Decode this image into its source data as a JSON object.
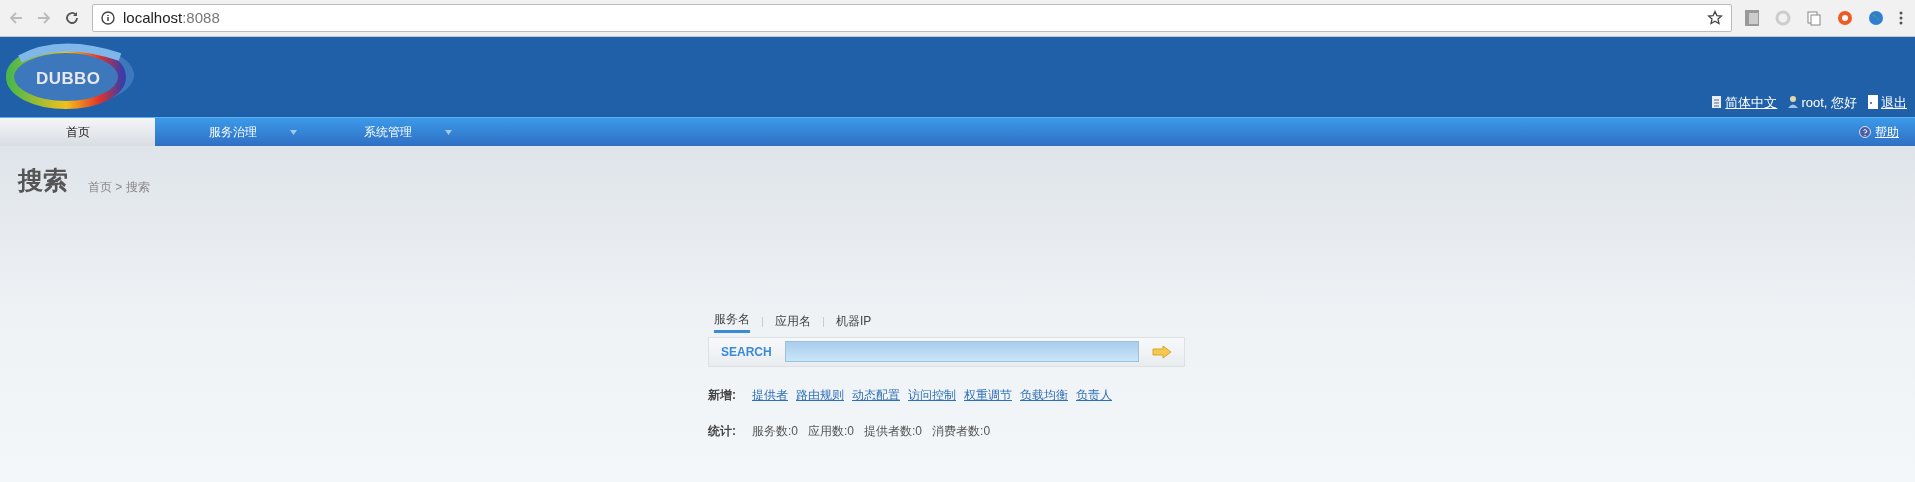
{
  "browser": {
    "url_host": "localhost",
    "url_port": ":8088"
  },
  "header": {
    "logo_text": "DUBBO",
    "links": [
      {
        "kind": "language",
        "label": "简体中文"
      },
      {
        "kind": "user",
        "label": "root, 您好"
      },
      {
        "kind": "logout",
        "label": "退出"
      }
    ]
  },
  "nav": {
    "items": [
      {
        "label": "首页",
        "selected": true,
        "dropdown": false
      },
      {
        "label": "服务治理",
        "selected": false,
        "dropdown": true
      },
      {
        "label": "系统管理",
        "selected": false,
        "dropdown": true
      }
    ],
    "help": "帮助"
  },
  "page": {
    "title": "搜索",
    "breadcrumb": "首页 > 搜索"
  },
  "search": {
    "tabs": [
      {
        "label": "服务名",
        "selected": true
      },
      {
        "label": "应用名",
        "selected": false
      },
      {
        "label": "机器IP",
        "selected": false
      }
    ],
    "label": "SEARCH"
  },
  "add": {
    "label": "新增:",
    "links": [
      "提供者",
      "路由规则",
      "动态配置",
      "访问控制",
      "权重调节",
      "负载均衡",
      "负责人"
    ]
  },
  "stats": {
    "label": "统计:",
    "items": [
      "服务数:0",
      "应用数:0",
      "提供者数:0",
      "消费者数:0"
    ]
  }
}
